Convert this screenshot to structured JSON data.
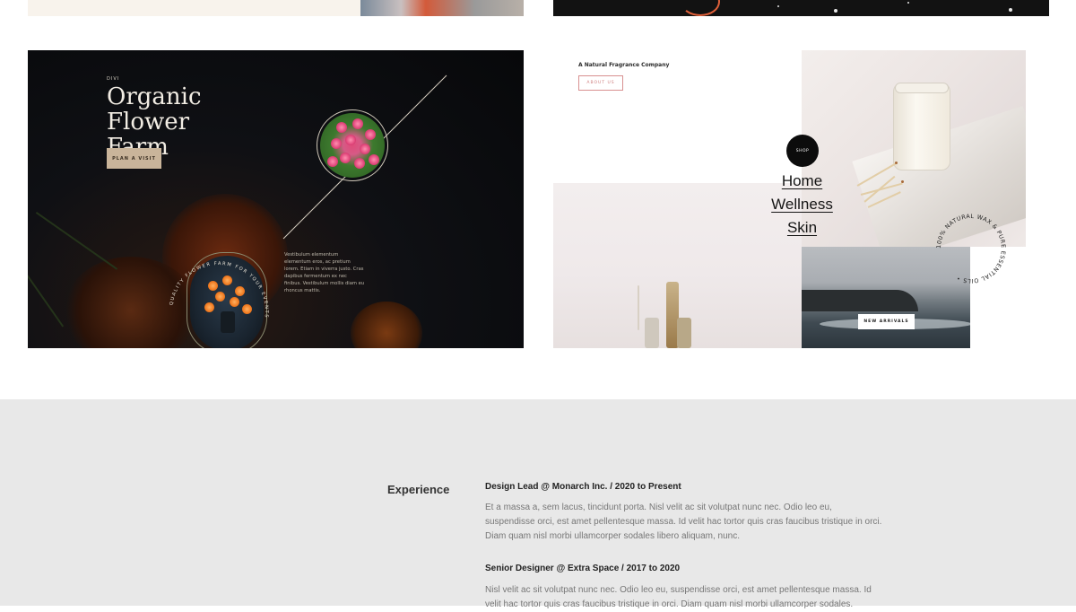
{
  "flower_farm": {
    "brand": "DIVI",
    "title_line1": "Organic Flower",
    "title_line2": "Farm",
    "cta": "PLAN A VISIT",
    "ring_text": "QUALITY FLOWER FARM FOR YOUR EVENTS",
    "paragraph": "Vestibulum elementum elementum eros, ac pretium lorem. Etiam in viverra justo. Cras dapibus fermentum ex nec finibus. Vestibulum mollis diam eu rhoncus mattis."
  },
  "fragrance": {
    "company": "A Natural Fragrance Company",
    "about_button": "ABOUT US",
    "shop_badge": "SHOP",
    "menu": [
      "Home",
      "Wellness",
      "Skin"
    ],
    "ring_text": "100% NATURAL WAX & PURE ESSENTIAL OILS •",
    "new_arrivals_button": "NEW ARRIVALS"
  },
  "resume": {
    "heading": "Experience",
    "jobs": [
      {
        "title": "Design Lead  @  Monarch Inc.  /  2020 to Present",
        "description": "Et a massa a, sem lacus, tincidunt porta. Nisl velit ac sit volutpat nunc nec. Odio leo eu, suspendisse orci, est amet pellentesque massa. Id velit hac tortor quis cras faucibus tristique in orci. Diam quam nisl morbi ullamcorper sodales libero aliquam, nunc."
      },
      {
        "title": "Senior Designer  @  Extra Space  /  2017 to 2020",
        "description": "Nisl velit ac sit volutpat nunc nec. Odio leo eu, suspendisse orci, est amet pellentesque massa. Id velit hac tortor quis cras faucibus tristique in orci. Diam quam nisl morbi ullamcorper sodales."
      }
    ]
  },
  "colors": {
    "page_bg": "#ffffff",
    "resume_bg": "#e8e8e8",
    "flower_button": "#c9b49a",
    "about_border": "#d89090"
  }
}
